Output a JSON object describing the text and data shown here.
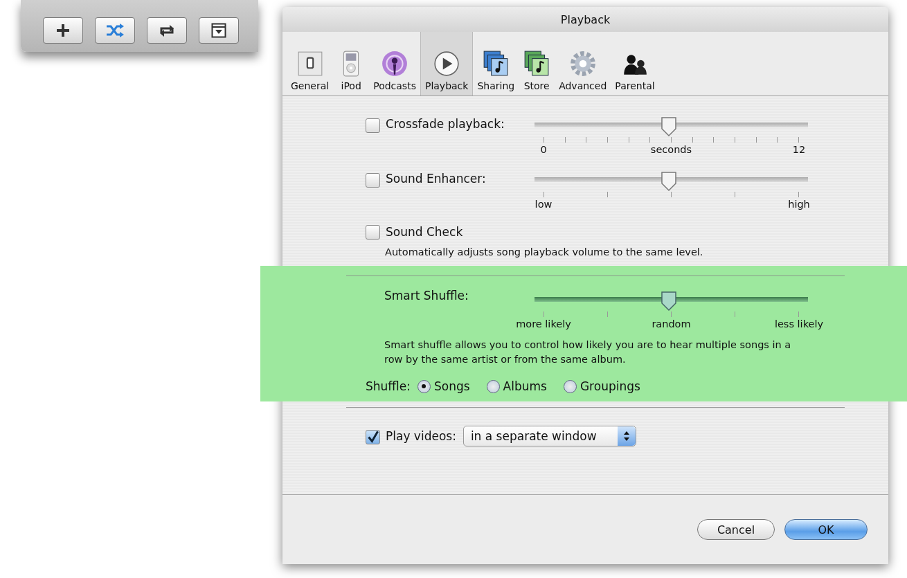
{
  "toolbar": {
    "buttons": [
      {
        "kind": "add",
        "on": false
      },
      {
        "kind": "shuffle",
        "on": true
      },
      {
        "kind": "repeat",
        "on": false
      },
      {
        "kind": "browse",
        "on": false
      }
    ]
  },
  "window": {
    "title": "Playback"
  },
  "tabs": [
    {
      "label": "General",
      "kind": "general",
      "selected": false
    },
    {
      "label": "iPod",
      "kind": "ipod",
      "selected": false
    },
    {
      "label": "Podcasts",
      "kind": "podcasts",
      "selected": false
    },
    {
      "label": "Playback",
      "kind": "playback",
      "selected": true
    },
    {
      "label": "Sharing",
      "kind": "sharing",
      "selected": false
    },
    {
      "label": "Store",
      "kind": "store",
      "selected": false
    },
    {
      "label": "Advanced",
      "kind": "advanced",
      "selected": false
    },
    {
      "label": "Parental",
      "kind": "parental",
      "selected": false
    }
  ],
  "crossfade": {
    "label": "Crossfade playback:",
    "checked": false,
    "level": 0.49,
    "scale_labels": [
      "0",
      "seconds",
      "12"
    ]
  },
  "sound_enhancer": {
    "label": "Sound Enhancer:",
    "checked": false,
    "level": 0.49,
    "scale_labels": [
      "low",
      "high"
    ]
  },
  "sound_check": {
    "label": "Sound Check",
    "checked": false,
    "description": "Automatically adjusts song playback volume to the same level."
  },
  "smart_shuffle": {
    "label": "Smart Shuffle:",
    "level": 0.49,
    "scale_labels": [
      "more likely",
      "random",
      "less likely"
    ],
    "description": "Smart shuffle allows you to control how likely you are to hear multiple songs in a row by the same artist or from the same album."
  },
  "shuffle": {
    "label": "Shuffle:",
    "options": [
      {
        "label": "Songs",
        "selected": true
      },
      {
        "label": "Albums",
        "selected": false
      },
      {
        "label": "Groupings",
        "selected": false
      }
    ]
  },
  "play_videos": {
    "label": "Play videos:",
    "checked": true,
    "value": "in a separate window"
  },
  "buttons": [
    {
      "label": "Cancel",
      "default": false
    },
    {
      "label": "OK",
      "default": true
    }
  ]
}
